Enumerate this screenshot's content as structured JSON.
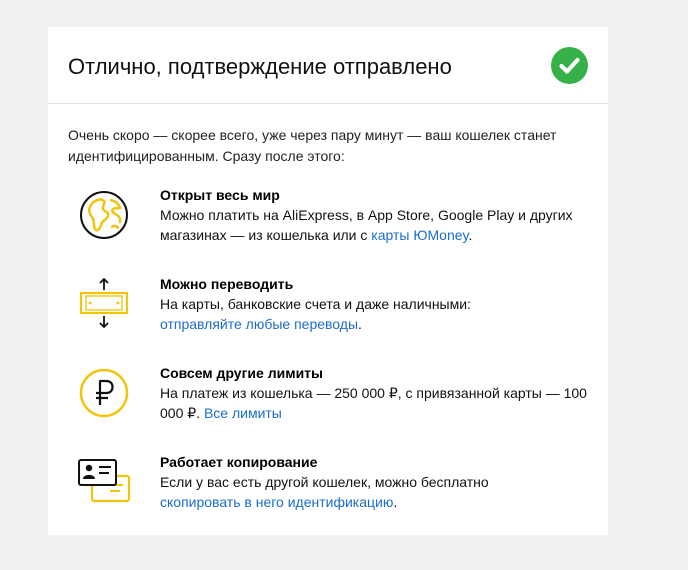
{
  "header": {
    "title": "Отлично, подтверждение отправлено",
    "check_icon": "check-circle-icon",
    "check_color": "#36b14a"
  },
  "intro": "Очень скоро — скорее всего, уже через пару минут — ваш кошелек станет идентифицированным. Сразу после этого:",
  "accent_color": "#ffdb4d",
  "link_color": "#1a6dcc",
  "items": [
    {
      "icon": "globe-icon",
      "title": "Открыт весь мир",
      "text": "Можно платить на AliExpress, в App Store, Google Play и других магазинах — из кошелька или с ",
      "link": "карты ЮMoney",
      "after": "."
    },
    {
      "icon": "transfer-icon",
      "title": "Можно переводить",
      "text": "На карты, банковские счета и даже наличными:",
      "link": "отправляйте любые переводы",
      "after": "."
    },
    {
      "icon": "ruble-icon",
      "title": "Совсем другие лимиты",
      "text": "На платеж из кошелька — 250 000 ₽, с привязанной карты — 100 000 ₽. ",
      "link": "Все лимиты",
      "after": ""
    },
    {
      "icon": "id-cards-icon",
      "title": "Работает копирование",
      "text": "Если у вас есть другой кошелек, можно бесплатно",
      "link": "скопировать в него идентификацию",
      "after": "."
    }
  ]
}
